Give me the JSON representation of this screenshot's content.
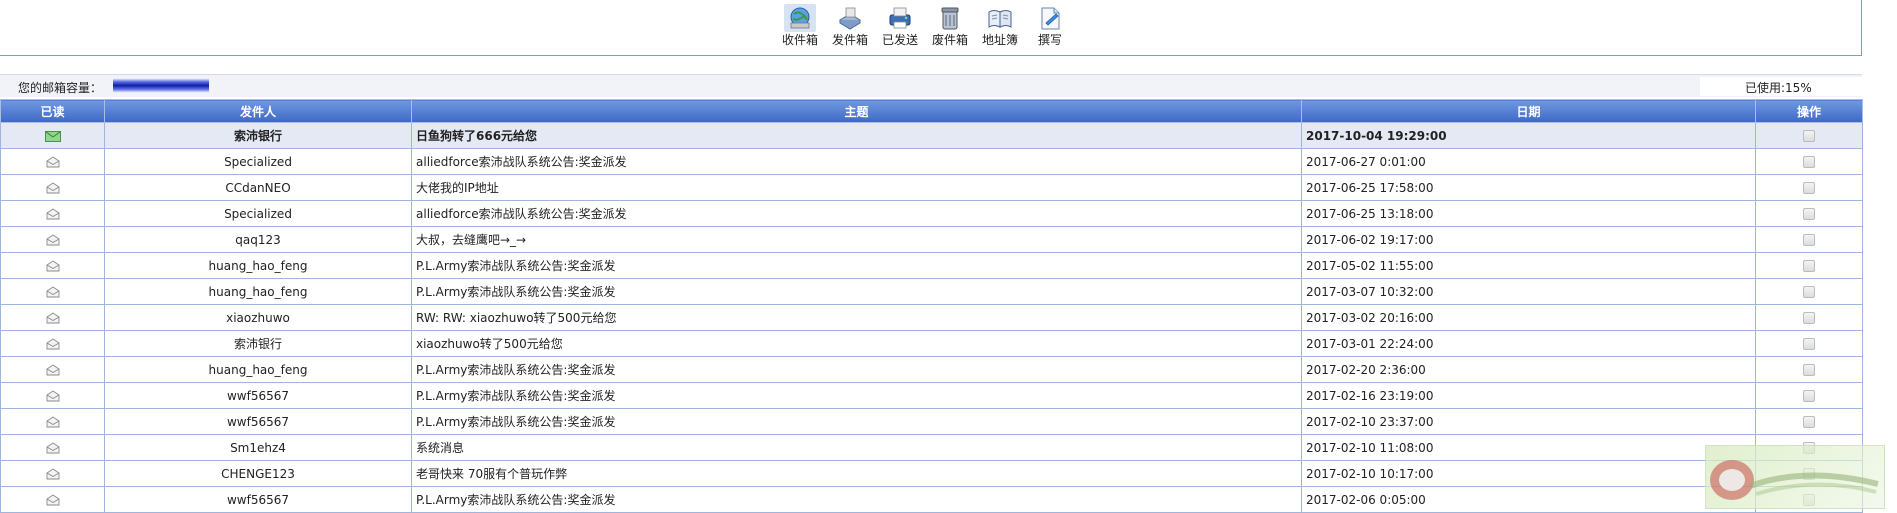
{
  "toolbar": {
    "items": [
      {
        "label": "收件箱",
        "icon": "inbox-globe-icon"
      },
      {
        "label": "发件箱",
        "icon": "outbox-icon"
      },
      {
        "label": "已发送",
        "icon": "sent-printer-icon"
      },
      {
        "label": "废件箱",
        "icon": "trash-can-icon"
      },
      {
        "label": "地址簿",
        "icon": "address-book-icon"
      },
      {
        "label": "撰写",
        "icon": "compose-icon"
      }
    ]
  },
  "capacity": {
    "label": "您的邮箱容量：",
    "used_label": "已使用:15%",
    "used_fraction": 0.15
  },
  "table": {
    "headers": [
      "已读",
      "发件人",
      "主题",
      "日期",
      "操作"
    ],
    "rows": [
      {
        "sender": "索沛银行",
        "subject": "日鱼狗转了666元给您",
        "date": "2017-10-04 19:29:00",
        "read": false
      },
      {
        "sender": "Specialized",
        "subject": "alliedforce索沛战队系统公告:奖金派发",
        "date": "2017-06-27 0:01:00",
        "read": true
      },
      {
        "sender": "CCdanNEO",
        "subject": "大佬我的IP地址",
        "date": "2017-06-25 17:58:00",
        "read": true
      },
      {
        "sender": "Specialized",
        "subject": "alliedforce索沛战队系统公告:奖金派发",
        "date": "2017-06-25 13:18:00",
        "read": true
      },
      {
        "sender": "qaq123",
        "subject": "大叔，去缝鹰吧→_→",
        "date": "2017-06-02 19:17:00",
        "read": true
      },
      {
        "sender": "huang_hao_feng",
        "subject": "P.L.Army索沛战队系统公告:奖金派发",
        "date": "2017-05-02 11:55:00",
        "read": true
      },
      {
        "sender": "huang_hao_feng",
        "subject": "P.L.Army索沛战队系统公告:奖金派发",
        "date": "2017-03-07 10:32:00",
        "read": true
      },
      {
        "sender": "xiaozhuwo",
        "subject": "RW: RW: xiaozhuwo转了500元给您",
        "date": "2017-03-02 20:16:00",
        "read": true
      },
      {
        "sender": "索沛银行",
        "subject": "xiaozhuwo转了500元给您",
        "date": "2017-03-01 22:24:00",
        "read": true
      },
      {
        "sender": "huang_hao_feng",
        "subject": "P.L.Army索沛战队系统公告:奖金派发",
        "date": "2017-02-20 2:36:00",
        "read": true
      },
      {
        "sender": "wwf56567",
        "subject": "P.L.Army索沛战队系统公告:奖金派发",
        "date": "2017-02-16 23:19:00",
        "read": true
      },
      {
        "sender": "wwf56567",
        "subject": "P.L.Army索沛战队系统公告:奖金派发",
        "date": "2017-02-10 23:37:00",
        "read": true
      },
      {
        "sender": "Sm1ehz4",
        "subject": "系统消息",
        "date": "2017-02-10 11:08:00",
        "read": true
      },
      {
        "sender": "CHENGE123",
        "subject": "老哥快来 70服有个普玩作弊",
        "date": "2017-02-10 10:17:00",
        "read": true
      },
      {
        "sender": "wwf56567",
        "subject": "P.L.Army索沛战队系统公告:奖金派发",
        "date": "2017-02-06 0:05:00",
        "read": true
      }
    ]
  },
  "colors": {
    "header_top": "#6f99e3",
    "header_bottom": "#3f68c4",
    "unread_row": "#e4e9f4",
    "grid": "#9fb5de"
  }
}
